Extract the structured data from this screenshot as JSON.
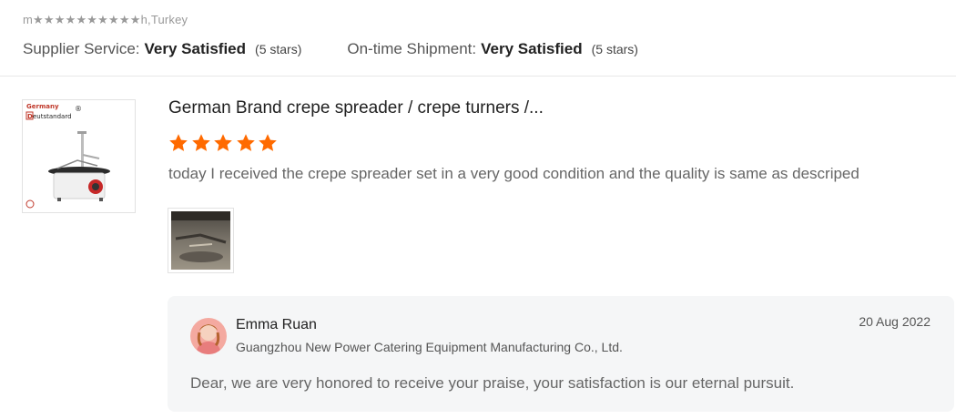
{
  "reviewer": {
    "name_location": "m★★★★★★★★★★h,Turkey"
  },
  "ratings": [
    {
      "label": "Supplier Service:",
      "value": "Very Satisfied",
      "stars_text": "(5 stars)"
    },
    {
      "label": "On-time Shipment:",
      "value": "Very Satisfied",
      "stars_text": "(5 stars)"
    }
  ],
  "product": {
    "title": "German Brand crepe spreader / crepe turners /...",
    "thumb_brand_top": "Germany",
    "thumb_brand_main": "eutstandard",
    "thumb_brand_initial": "D",
    "thumb_registered": "®"
  },
  "review": {
    "star_count": 5,
    "star_color": "#ff6a00",
    "text": "today I received the crepe spreader set in a very good condition and the quality is same as descriped"
  },
  "reply": {
    "name": "Emma Ruan",
    "company": "Guangzhou New Power Catering Equipment Manufacturing Co., Ltd.",
    "date": "20 Aug 2022",
    "text": "Dear, we are very honored to receive your praise, your satisfaction is our eternal pursuit."
  }
}
